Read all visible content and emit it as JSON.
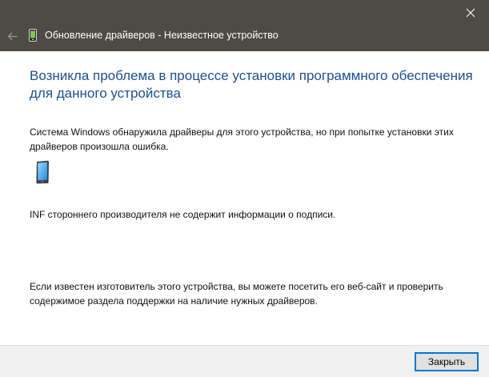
{
  "window": {
    "title": "Обновление драйверов - Неизвестное устройство",
    "titlebar_color": "#4e4a46",
    "back_icon": "back-arrow-icon",
    "close_icon": "close-icon"
  },
  "content": {
    "heading": "Возникла проблема в процессе установки программного обеспечения для данного устройства",
    "heading_color": "#1d4f91",
    "description": "Система Windows обнаружила драйверы для этого устройства, но при попытке установки этих драйверов произошла ошибка.",
    "device_icon": "mobile-device-icon",
    "error_message": "INF стороннего производителя не содержит информации о подписи.",
    "advice": "Если известен изготовитель этого устройства, вы можете посетить его веб-сайт и проверить содержимое раздела поддержки на наличие нужных драйверов."
  },
  "footer": {
    "close_button_label": "Закрыть",
    "accent_color": "#0078d7"
  }
}
